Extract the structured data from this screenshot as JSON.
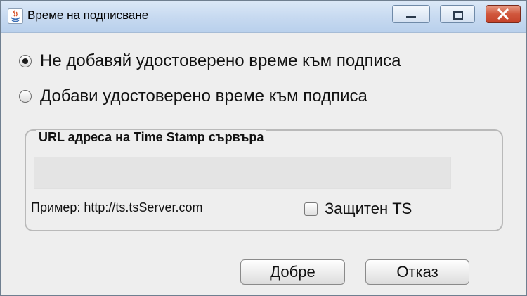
{
  "window": {
    "title": "Време на подписване"
  },
  "options": {
    "no_timestamp": "Не добавяй удостоверено време към подписа",
    "add_timestamp": "Добави удостоверено време към подписа",
    "selected": "no_timestamp"
  },
  "group": {
    "legend": "URL адреса на Time Stamp сървъра",
    "url_value": "",
    "example": "Пример: http://ts.tsServer.com",
    "secure_ts_label": "Защитен TS",
    "secure_ts_checked": false
  },
  "buttons": {
    "ok": "Добре",
    "cancel": "Отказ"
  },
  "icons": {
    "app": "java-icon",
    "minimize": "minimize-icon",
    "maximize": "maximize-icon",
    "close": "close-icon"
  }
}
